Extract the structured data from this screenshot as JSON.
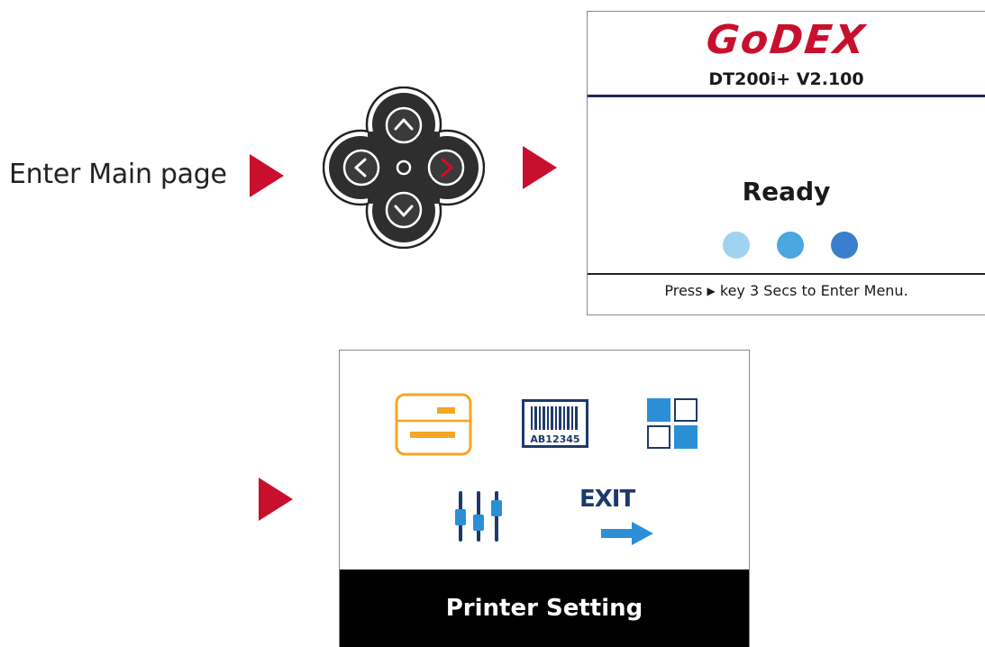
{
  "step": {
    "label": "Enter Main page"
  },
  "keypad": {
    "buttons": [
      "up-key",
      "down-key",
      "left-key",
      "right-key",
      "ok-key"
    ],
    "highlight_color": "#c8102e"
  },
  "main_screen": {
    "brand": "GoDEX",
    "model": "DT200i+ V2.100",
    "status": "Ready",
    "hint_prefix": "Press",
    "hint_suffix": "key 3 Secs to Enter Menu.",
    "dot_colors": [
      "#9fd3ef",
      "#4aa7e0",
      "#3a7fcb"
    ]
  },
  "menu_screen": {
    "exit_label": "EXIT",
    "barcode_text": "AB12345",
    "selected_label": "Printer Setting",
    "icons": [
      "label-setting-icon",
      "barcode-icon",
      "settings-grid-icon",
      "sliders-icon",
      "exit-arrow-icon"
    ],
    "accent_orange": "#f5a623",
    "accent_blue": "#2b8fd6"
  },
  "colors": {
    "arrow": "#c8102e",
    "header_rule": "#1b2a5a"
  }
}
